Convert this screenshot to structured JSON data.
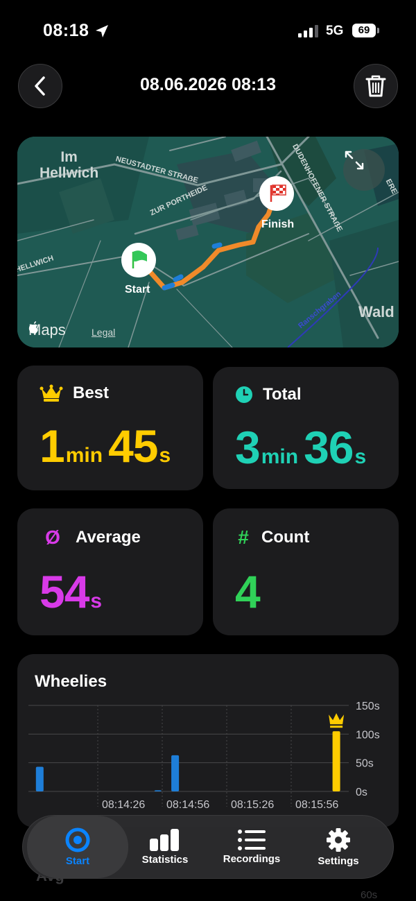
{
  "status_bar": {
    "time": "08:18",
    "network": "5G",
    "battery": "69"
  },
  "header": {
    "title": "08.06.2026 08:13"
  },
  "map": {
    "places": {
      "im_hellwich": "Im\nHellwich",
      "hellwich": "HELLWICH",
      "neustadter": "NEUSTADTER STRAẞE",
      "zur_portheide": "ZUR PORTHEIDE",
      "dudenhofener": "DUDENHOFENER STRAẞE",
      "wald": "Wald",
      "ranschgraben": "Ranschgraben",
      "edge": "ERE"
    },
    "start_label": "Start",
    "finish_label": "Finish",
    "maps_brand": "Maps",
    "legal": "Legal",
    "colors": {
      "route": "#f08a2a",
      "route_alt": "#1e7ed8",
      "water": "#2e3ab8"
    }
  },
  "stats": {
    "best": {
      "label": "Best",
      "minutes": "1",
      "min_unit": "min",
      "seconds": "45",
      "sec_unit": "s",
      "color": "#ffcc00"
    },
    "total": {
      "label": "Total",
      "minutes": "3",
      "min_unit": "min",
      "seconds": "36",
      "sec_unit": "s",
      "color": "#1fd1b5"
    },
    "average": {
      "label": "Average",
      "seconds": "54",
      "sec_unit": "s",
      "color": "#d83ae8",
      "icon": "Ø"
    },
    "count": {
      "label": "Count",
      "value": "4",
      "color": "#30d158",
      "icon": "#"
    }
  },
  "chart_data": {
    "type": "bar",
    "title": "Wheelies",
    "y_ticks": [
      "150s",
      "100s",
      "50s",
      "0s"
    ],
    "ylim": [
      0,
      150
    ],
    "x_ticks": [
      "08:14:26",
      "08:14:56",
      "08:15:26",
      "08:15:56"
    ],
    "bars": [
      {
        "x": "08:13:59",
        "value": 43,
        "color": "#1e7ed8"
      },
      {
        "x": "08:14:54",
        "value": 2,
        "color": "#1e7ed8"
      },
      {
        "x": "08:15:02",
        "value": 63,
        "color": "#1e7ed8"
      },
      {
        "x": "08:16:17",
        "value": 105,
        "color": "#ffcc00",
        "best": true
      }
    ],
    "grid": true
  },
  "tabbar": {
    "tabs": [
      {
        "label": "Start",
        "active": true
      },
      {
        "label": "Statistics",
        "active": false
      },
      {
        "label": "Recordings",
        "active": false
      },
      {
        "label": "Settings",
        "active": false
      }
    ]
  },
  "below_fold": {
    "title": "Avg",
    "tick": "60s"
  }
}
